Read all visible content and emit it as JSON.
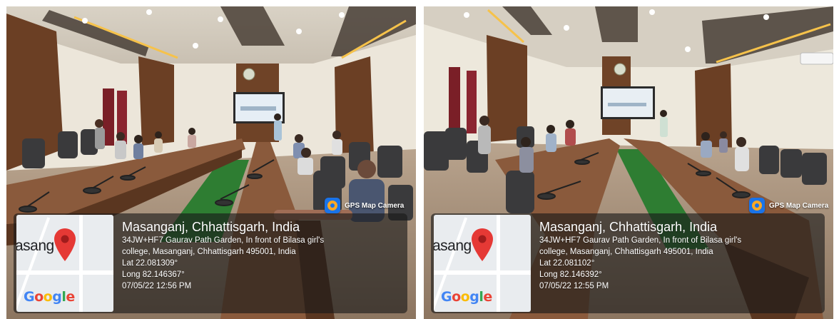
{
  "photos": [
    {
      "brand": {
        "icon": "gps-map-camera-icon",
        "label": "GPS Map Camera"
      },
      "map": {
        "place_text": "asang",
        "logo_text": "Google",
        "pin_icon": "location-pin-icon"
      },
      "location_title": "Masanganj, Chhattisgarh, India",
      "address_line1": "34JW+HF7 Gaurav Path Garden, In front of Bilasa girl's",
      "address_line2": "college, Masanganj, Chhattisgarh 495001, India",
      "lat": "Lat 22.081309°",
      "long": "Long 82.146367°",
      "datetime": "07/05/22 12:56 PM"
    },
    {
      "brand": {
        "icon": "gps-map-camera-icon",
        "label": "GPS Map Camera"
      },
      "map": {
        "place_text": "asang",
        "logo_text": "Google",
        "pin_icon": "location-pin-icon"
      },
      "location_title": "Masanganj, Chhattisgarh, India",
      "address_line1": "34JW+HF7 Gaurav Path Garden, In front of Bilasa girl's",
      "address_line2": "college, Masanganj, Chhattisgarh 495001, India",
      "lat": "Lat 22.081102°",
      "long": "Long 82.146392°",
      "datetime": "07/05/22 12:55 PM"
    }
  ],
  "colors": {
    "overlay": "#191919",
    "pin": "#e53935",
    "brand_icon": "#1a73e8",
    "carpet": "#2e7d32",
    "wood": "#6b3f24",
    "table": "#8a5a3c"
  }
}
